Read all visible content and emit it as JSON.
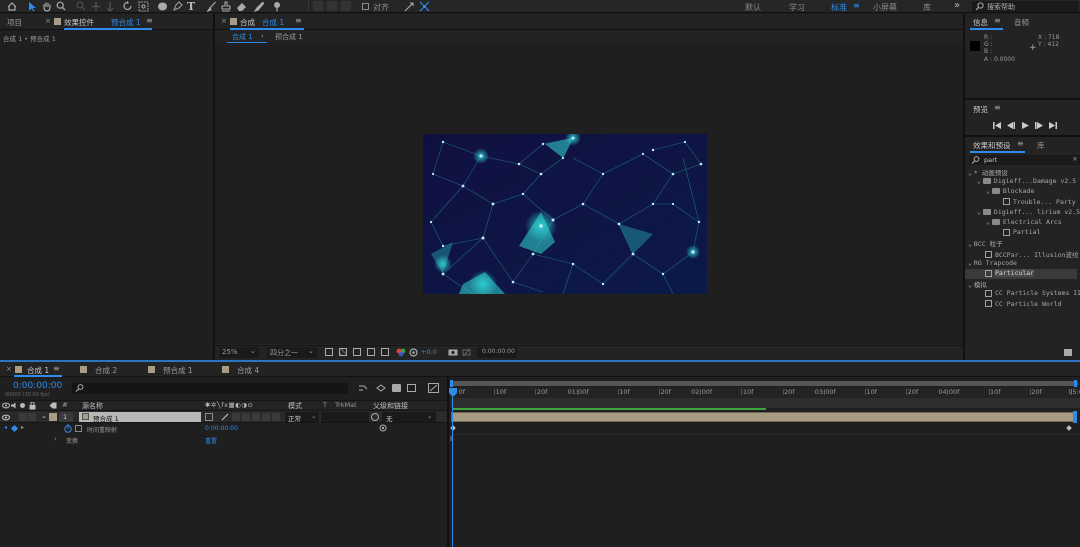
{
  "toolbar": {
    "snap_label": "对齐",
    "workspaces": [
      "默认",
      "学习",
      "标准",
      "小屏幕",
      "库"
    ],
    "active_workspace": "标准",
    "more": "»",
    "search_placeholder": "搜索帮助"
  },
  "project_panel": {
    "tab_project": "项目",
    "tab_effect_controls": "效果控件",
    "tab_effect_target": "预合成 1",
    "breadcrumb": "合成 1 • 预合成 1"
  },
  "comp_panel": {
    "tab_label": "合成",
    "tab_target": "合成 1",
    "sub_tab_active": "合成 1",
    "sub_tab_other": "预合成 1",
    "zoom": "25%",
    "resolution": "四分之一",
    "exposure": "+0.0",
    "timecode": "0:00:00:00"
  },
  "info_panel": {
    "tab_info": "信息",
    "tab_audio": "音频",
    "r": "R :",
    "g": "G :",
    "b": "B :",
    "a": "A : 0.0000",
    "x": "X : 718",
    "y": "Y : 412"
  },
  "preview_panel": {
    "title": "预览"
  },
  "effects_panel": {
    "tab_effects": "效果和预设",
    "tab_library": "库",
    "search_value": "part",
    "tree": [
      {
        "text": "* 动画预设",
        "level": 0,
        "kind": "group"
      },
      {
        "text": "Digieff...Damage v2.5",
        "level": 1,
        "kind": "folder"
      },
      {
        "text": "Blockade",
        "level": 2,
        "kind": "folder"
      },
      {
        "text": "Trouble... Party",
        "level": 3,
        "kind": "preset"
      },
      {
        "text": "Digieff... lirium v2.5",
        "level": 1,
        "kind": "folder"
      },
      {
        "text": "Electrical Arcs",
        "level": 2,
        "kind": "folder"
      },
      {
        "text": "Partial",
        "level": 3,
        "kind": "preset"
      },
      {
        "text": "BCC 粒子",
        "level": 0,
        "kind": "group"
      },
      {
        "text": "BCCPar... Illusion波纹",
        "level": 1,
        "kind": "preset"
      },
      {
        "text": "RG Trapcode",
        "level": 0,
        "kind": "group"
      },
      {
        "text": "Particular",
        "level": 1,
        "kind": "preset",
        "selected": true
      },
      {
        "text": "模拟",
        "level": 0,
        "kind": "group"
      },
      {
        "text": "CC Particle Systems II",
        "level": 1,
        "kind": "preset"
      },
      {
        "text": "CC Particle World",
        "level": 1,
        "kind": "preset"
      }
    ]
  },
  "timeline": {
    "tabs": [
      "合成 1",
      "合成 2",
      "预合成 1",
      "合成 4"
    ],
    "timecode": "0:00:00:00",
    "timecode_sub": "00000 (30.00 fps)",
    "col_source": "源名称",
    "col_mode": "模式",
    "col_trkmat": "TrkMat",
    "col_parent": "父级和链接",
    "layer_num": "1",
    "layer_name": "预合成 1",
    "layer_mode": "正常",
    "layer_parent": "无",
    "remap_label": "时间重映射",
    "remap_value": "0:00:00:00",
    "transform_label": "变换",
    "transform_value": "重置",
    "ruler": [
      "0f",
      "10f",
      "20f",
      "01:00f",
      "10f",
      "20f",
      "02:00f",
      "10f",
      "20f",
      "03:00f",
      "10f",
      "20f",
      "04:00f",
      "10f",
      "20f",
      "05:0"
    ],
    "colors": {
      "accent": "#2d8ceb",
      "layer_bar": "#a89c85",
      "work_area": "#3fa63f",
      "label_tan": "#a89c85"
    }
  }
}
